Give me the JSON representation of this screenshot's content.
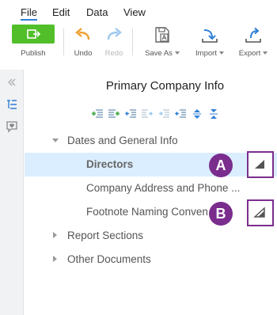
{
  "menu": {
    "items": [
      "File",
      "Edit",
      "Data",
      "View"
    ]
  },
  "toolbar": {
    "publish": "Publish",
    "undo": "Undo",
    "redo": "Redo",
    "save_as": "Save As",
    "import": "Import",
    "export": "Export"
  },
  "panel": {
    "title": "Primary Company Info"
  },
  "tree": {
    "section1": "Dates and General Info",
    "child1": "Directors",
    "child2": "Company Address and Phone ...",
    "child3": "Footnote Naming Conven",
    "section2": "Report Sections",
    "section3": "Other Documents"
  },
  "callouts": {
    "a": "A",
    "b": "B"
  },
  "colors": {
    "accent": "#2f7fd6",
    "publish_green": "#52bf2a",
    "selected_row": "#dbeeff",
    "callout_purple": "#7b2d8e"
  }
}
